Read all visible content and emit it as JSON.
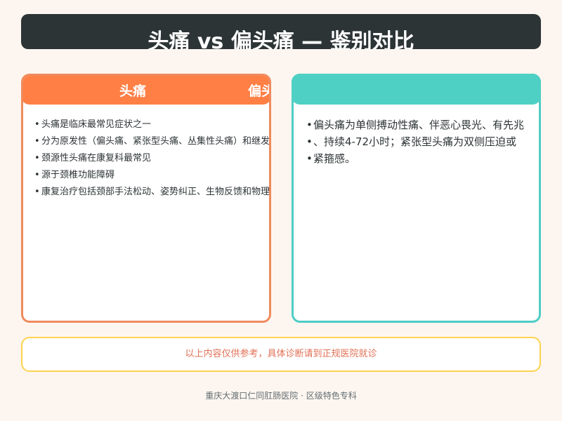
{
  "title": "头痛 vs 偏头痛 — 鉴别对比",
  "left_panel": {
    "header": "头痛",
    "header_overflow": "偏头痛",
    "items": [
      "头痛是临床最常见症状之一",
      "分为原发性（偏头痛、紧张型头痛、丛集性头痛）和继发性",
      "颈源性头痛在康复科最常见",
      "源于颈椎功能障碍",
      "康复治疗包括颈部手法松动、姿势纠正、生物反馈和物理治疗"
    ]
  },
  "right_panel": {
    "header": "",
    "items": [
      "偏头痛为单侧搏动性痛、伴恶心畏光、有先兆",
      "、持续4-72小时；紧张型头痛为双侧压迫或",
      "紧箍感。"
    ]
  },
  "bullet": "•",
  "notice": "以上内容仅供参考，具体诊断请到正规医院就诊",
  "footer": "重庆大渡口仁同肛肠医院 · 区级特色专科",
  "colors": {
    "title_bg": "#2d3436",
    "left_accent": "#ff7f45",
    "right_accent": "#4fd0c4",
    "notice_border": "#fdd24f",
    "notice_text": "#e17055",
    "page_bg": "#fdf6f0"
  }
}
